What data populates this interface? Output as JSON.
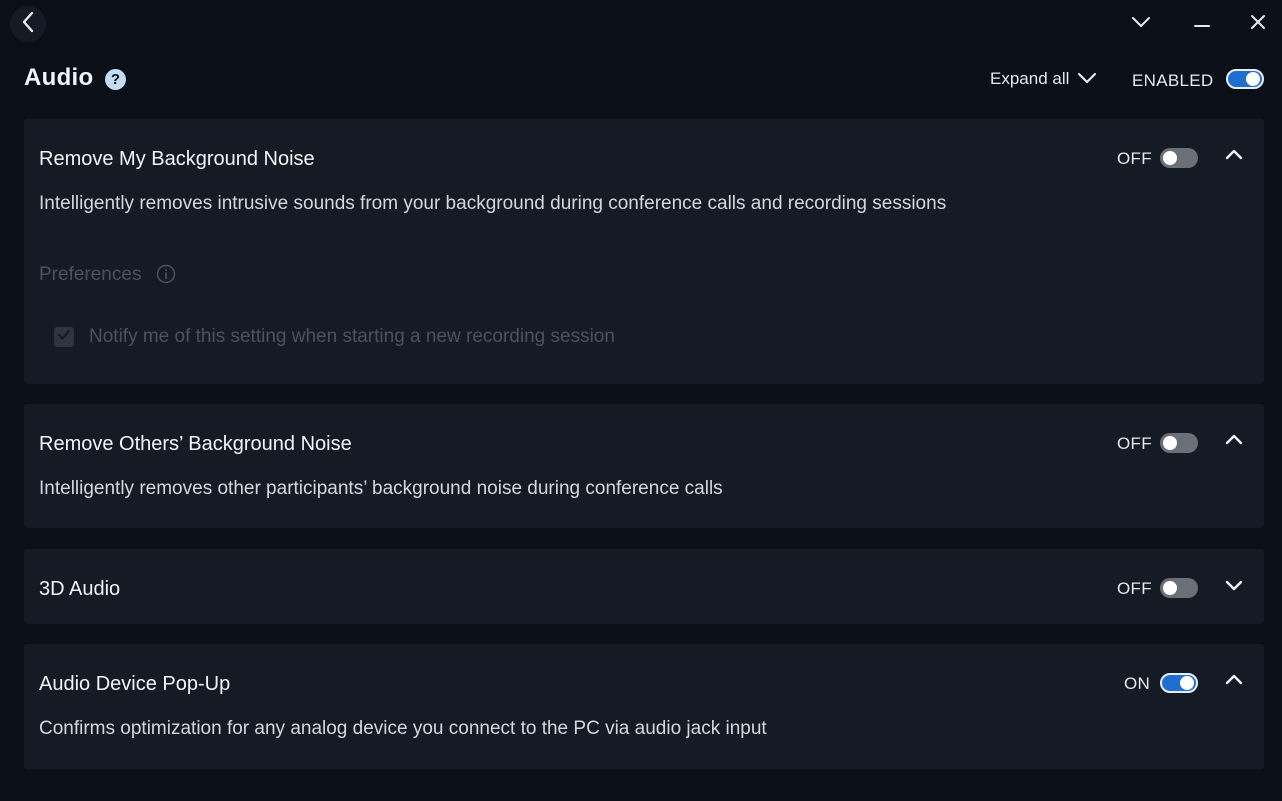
{
  "window": {
    "back_icon": "chevron-left-icon",
    "controls": [
      "chevron-down-icon",
      "minimize-icon",
      "close-icon"
    ]
  },
  "header": {
    "title": "Audio",
    "help_glyph": "?",
    "expand_all_label": "Expand all",
    "master_label": "ENABLED",
    "master_state": true
  },
  "cards": [
    {
      "title": "Remove My Background Noise",
      "description": "Intelligently removes intrusive sounds from your background during conference calls and recording sessions",
      "state_label": "OFF",
      "enabled": false,
      "expanded": true,
      "preferences": {
        "label": "Preferences",
        "checkbox_label": "Notify me of this setting when starting a new recording session",
        "checked": true,
        "disabled": true
      }
    },
    {
      "title": "Remove Others’ Background Noise",
      "description": "Intelligently removes other participants’ background noise during conference calls",
      "state_label": "OFF",
      "enabled": false,
      "expanded": true
    },
    {
      "title": "3D Audio",
      "state_label": "OFF",
      "enabled": false,
      "expanded": false
    },
    {
      "title": "Audio Device Pop-Up",
      "description": "Confirms optimization for any analog device you connect to the PC via audio jack input",
      "state_label": "ON",
      "enabled": true,
      "expanded": true
    }
  ],
  "colors": {
    "background": "#0b0f17",
    "card": "#151b25",
    "accent": "#1f6fd1",
    "toggle_off": "#6a6f78",
    "disabled_text": "#4a5160"
  }
}
